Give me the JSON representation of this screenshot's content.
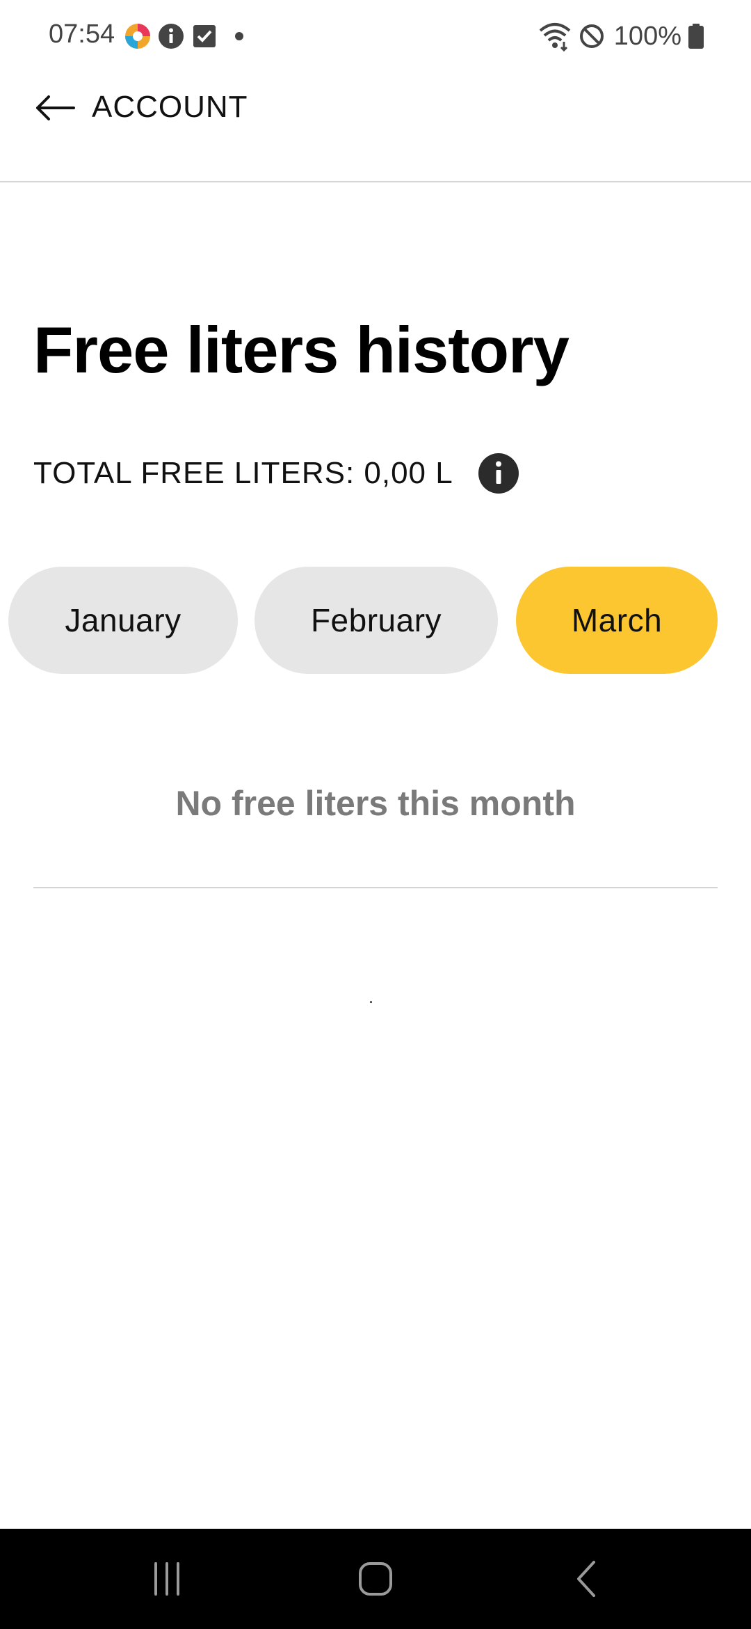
{
  "status_bar": {
    "time": "07:54",
    "notification_icons": [
      "colorful-app-icon",
      "info-icon",
      "checkbox-icon",
      "dot-icon"
    ],
    "system_icons": [
      "wifi-icon",
      "dnd-icon",
      "battery-icon"
    ],
    "battery": "100%"
  },
  "app_bar": {
    "back_icon": "arrow-left-icon",
    "title": "ACCOUNT"
  },
  "page": {
    "title": "Free liters history",
    "total_label": "TOTAL FREE LITERS: 0,00 L",
    "info_icon": "info-icon"
  },
  "months": {
    "items": [
      {
        "label": "January",
        "selected": false
      },
      {
        "label": "February",
        "selected": false
      },
      {
        "label": "March",
        "selected": true
      }
    ],
    "active_color": "#fcc630",
    "inactive_color": "#e6e6e6"
  },
  "empty_state": {
    "message": "No free liters this month"
  },
  "nav_bar": {
    "buttons": [
      "recents-icon",
      "home-icon",
      "back-icon"
    ]
  }
}
